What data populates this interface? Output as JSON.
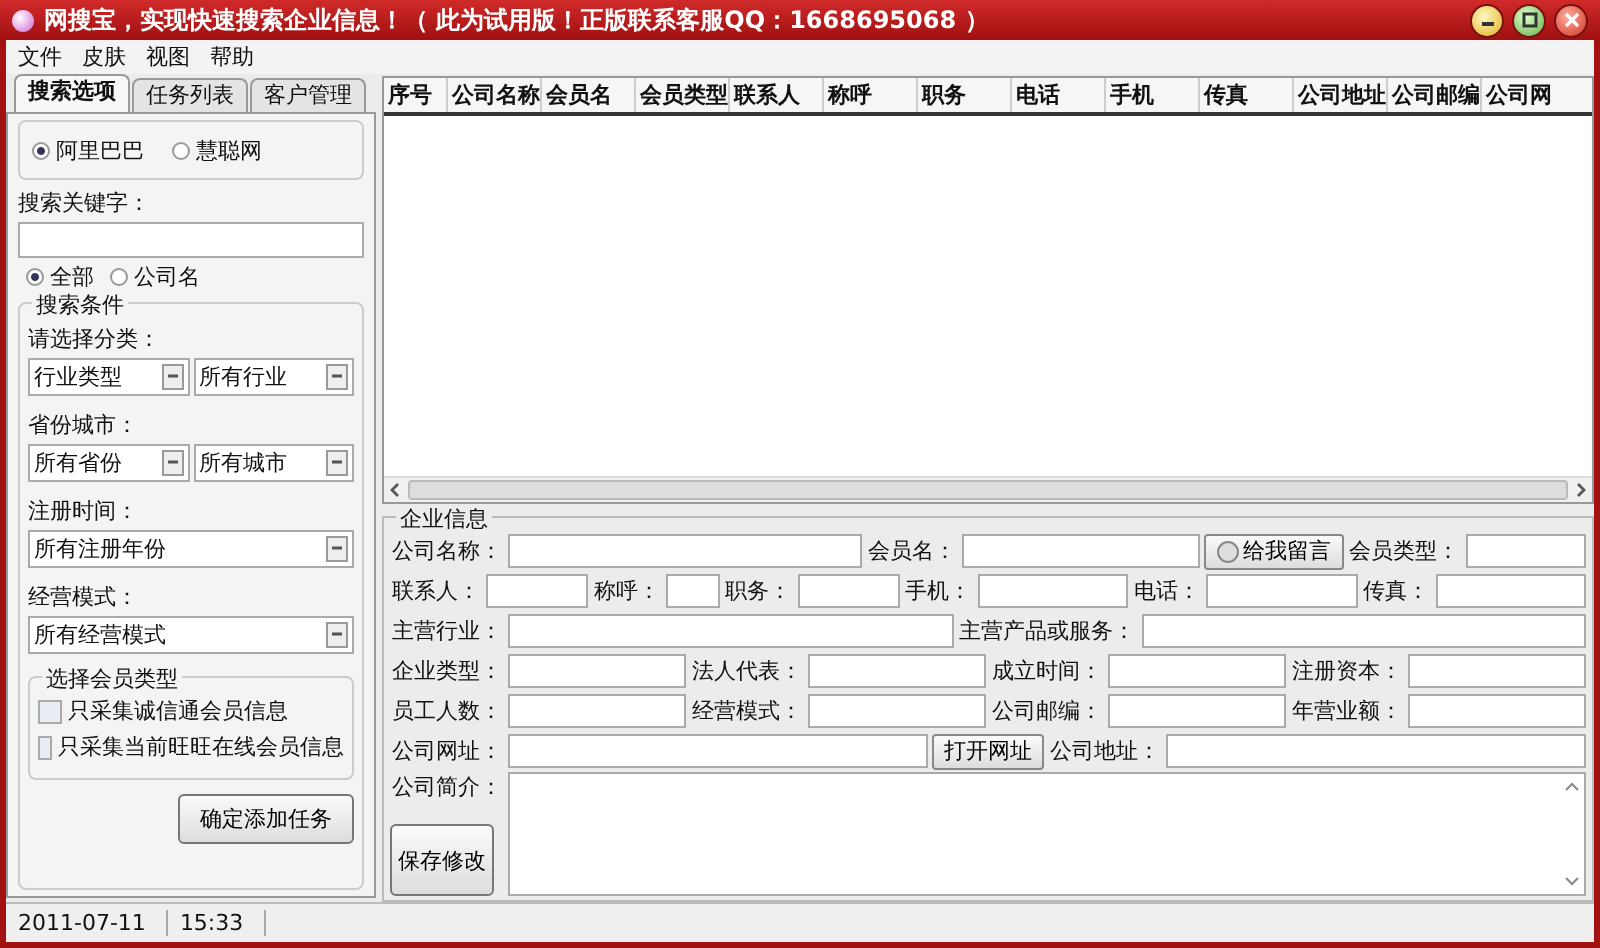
{
  "window": {
    "title": "网搜宝，实现快速搜索企业信息！（ 此为试用版！正版联系客服QQ：1668695068 ）"
  },
  "menu": [
    "文件",
    "皮肤",
    "视图",
    "帮助"
  ],
  "tabs": [
    {
      "label": "搜索选项",
      "selected": true
    },
    {
      "label": "任务列表",
      "selected": false
    },
    {
      "label": "客户管理",
      "selected": false
    }
  ],
  "source": [
    {
      "label": "阿里巴巴",
      "selected": true
    },
    {
      "label": "慧聪网",
      "selected": false
    }
  ],
  "keyword": {
    "label": "搜索关键字："
  },
  "scope": [
    {
      "label": "全部",
      "selected": true
    },
    {
      "label": "公司名",
      "selected": false
    }
  ],
  "conditions": {
    "title": "搜索条件",
    "groups": [
      {
        "label": "请选择分类：",
        "selects": [
          "行业类型",
          "所有行业"
        ]
      },
      {
        "label": "省份城市：",
        "selects": [
          "所有省份",
          "所有城市"
        ]
      },
      {
        "label": "注册时间：",
        "selects": [
          "所有注册年份"
        ]
      },
      {
        "label": "经营模式：",
        "selects": [
          "所有经营模式"
        ]
      }
    ],
    "member_types": {
      "title": "选择会员类型",
      "options": [
        {
          "label": "只采集诚信通会员信息",
          "checked": false
        },
        {
          "label": "只采集当前旺旺在线会员信息",
          "checked": false
        }
      ]
    },
    "submit": "确定添加任务"
  },
  "table": {
    "columns": [
      "序号",
      "公司名称",
      "会员名",
      "会员类型",
      "联系人",
      "称呼",
      "职务",
      "电话",
      "手机",
      "传真",
      "公司地址",
      "公司邮编",
      "公司网"
    ]
  },
  "company_info": {
    "title": "企业信息",
    "rows": [
      [
        {
          "kind": "label",
          "text": "公司名称："
        },
        {
          "kind": "field"
        },
        {
          "kind": "label",
          "text": "会员名："
        },
        {
          "kind": "field"
        },
        {
          "kind": "message_button",
          "text": "给我留言"
        },
        {
          "kind": "label",
          "text": "会员类型："
        },
        {
          "kind": "field"
        }
      ],
      [
        {
          "kind": "label",
          "text": "联系人："
        },
        {
          "kind": "field"
        },
        {
          "kind": "label",
          "text": "称呼："
        },
        {
          "kind": "field"
        },
        {
          "kind": "label",
          "text": "职务："
        },
        {
          "kind": "field"
        },
        {
          "kind": "label",
          "text": "手机："
        },
        {
          "kind": "field"
        },
        {
          "kind": "label",
          "text": "电话："
        },
        {
          "kind": "field"
        },
        {
          "kind": "label",
          "text": "传真："
        },
        {
          "kind": "field"
        }
      ],
      [
        {
          "kind": "label",
          "text": "主营行业："
        },
        {
          "kind": "field"
        },
        {
          "kind": "label",
          "text": "主营产品或服务："
        },
        {
          "kind": "field"
        }
      ],
      [
        {
          "kind": "label",
          "text": "企业类型："
        },
        {
          "kind": "field"
        },
        {
          "kind": "label",
          "text": "法人代表："
        },
        {
          "kind": "field"
        },
        {
          "kind": "label",
          "text": "成立时间："
        },
        {
          "kind": "field"
        },
        {
          "kind": "label",
          "text": "注册资本："
        },
        {
          "kind": "field"
        }
      ],
      [
        {
          "kind": "label",
          "text": "员工人数："
        },
        {
          "kind": "field"
        },
        {
          "kind": "label",
          "text": "经营模式："
        },
        {
          "kind": "field"
        },
        {
          "kind": "label",
          "text": "公司邮编："
        },
        {
          "kind": "field"
        },
        {
          "kind": "label",
          "text": "年营业额："
        },
        {
          "kind": "field"
        }
      ],
      [
        {
          "kind": "label",
          "text": "公司网址："
        },
        {
          "kind": "field"
        },
        {
          "kind": "button",
          "text": "打开网址"
        },
        {
          "kind": "label",
          "text": "公司地址："
        },
        {
          "kind": "field"
        }
      ]
    ],
    "intro_label": "公司简介：",
    "save": "保存修改"
  },
  "status_bar": [
    "2011-07-11",
    "15:33"
  ]
}
